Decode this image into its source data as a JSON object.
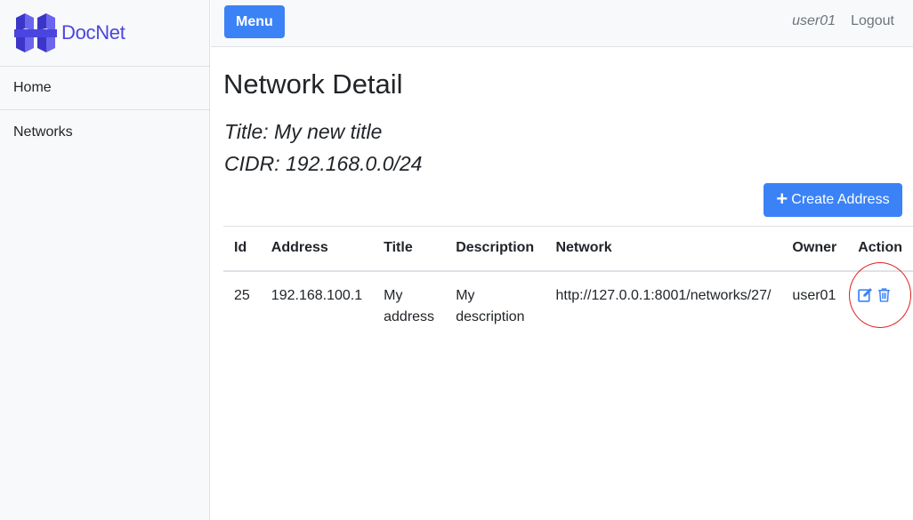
{
  "brand": {
    "name": "DocNet"
  },
  "sidebar": {
    "items": [
      {
        "label": "Home"
      },
      {
        "label": "Networks"
      }
    ]
  },
  "topbar": {
    "menu_label": "Menu",
    "username": "user01",
    "logout_label": "Logout"
  },
  "page": {
    "heading": "Network Detail",
    "title_line": "Title: My new title",
    "cidr_line": "CIDR: 192.168.0.0/24",
    "create_button_label": "Create Address"
  },
  "table": {
    "headers": [
      "Id",
      "Address",
      "Title",
      "Description",
      "Network",
      "Owner",
      "Action"
    ],
    "rows": [
      {
        "id": "25",
        "address": "192.168.100.1",
        "title": "My address",
        "description": "My description",
        "network": "http://127.0.0.1:8001/networks/27/",
        "owner": "user01",
        "actions": [
          "edit-icon",
          "trash-icon"
        ]
      }
    ]
  },
  "colors": {
    "primary": "#3b82f6",
    "brand": "#4b45e0",
    "annotation": "#e11d1d"
  }
}
